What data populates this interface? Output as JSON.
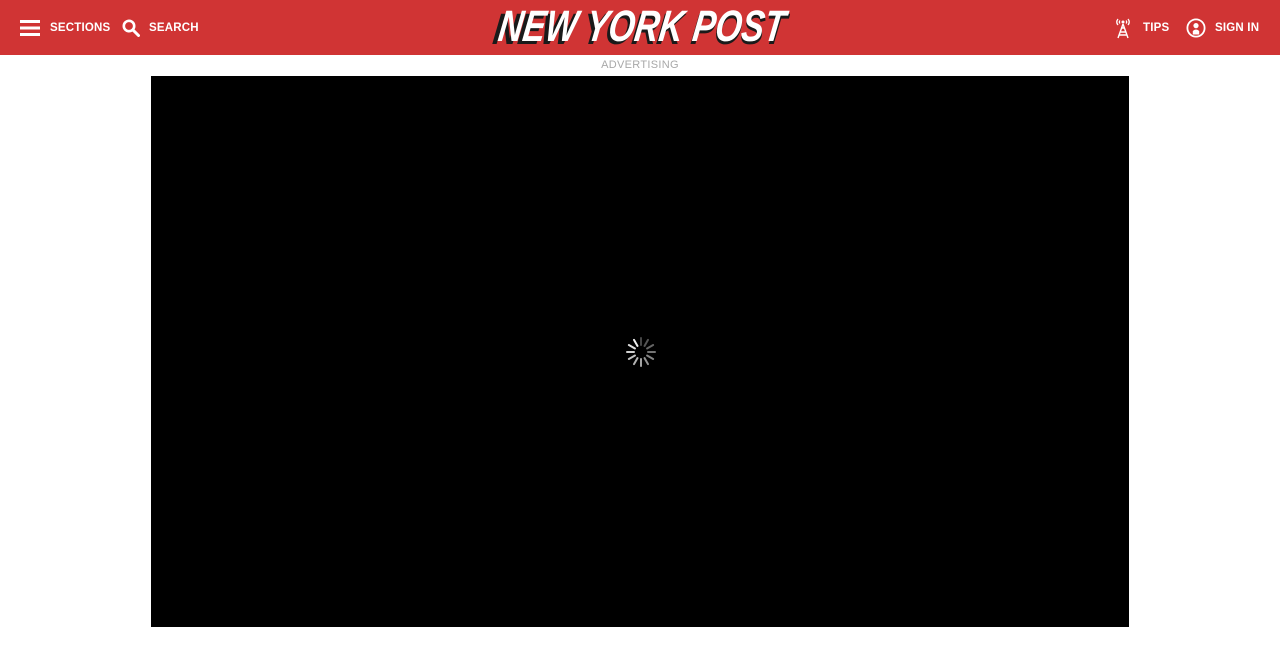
{
  "header": {
    "background_color": "#d03434",
    "sections": {
      "label": "SECTIONS",
      "icon": "hamburger-menu-icon"
    },
    "search": {
      "label": "SEARCH",
      "icon": "search-icon"
    },
    "logo": {
      "text": "NEW YORK POST"
    },
    "tips": {
      "label": "TIPS",
      "icon": "broadcast-tower-icon"
    },
    "signin": {
      "label": "SIGN IN",
      "icon": "user-circle-icon"
    }
  },
  "advertisement": {
    "label": "ADVERTISING",
    "player_background": "#000000",
    "status_icon": "loading-spinner-icon"
  }
}
